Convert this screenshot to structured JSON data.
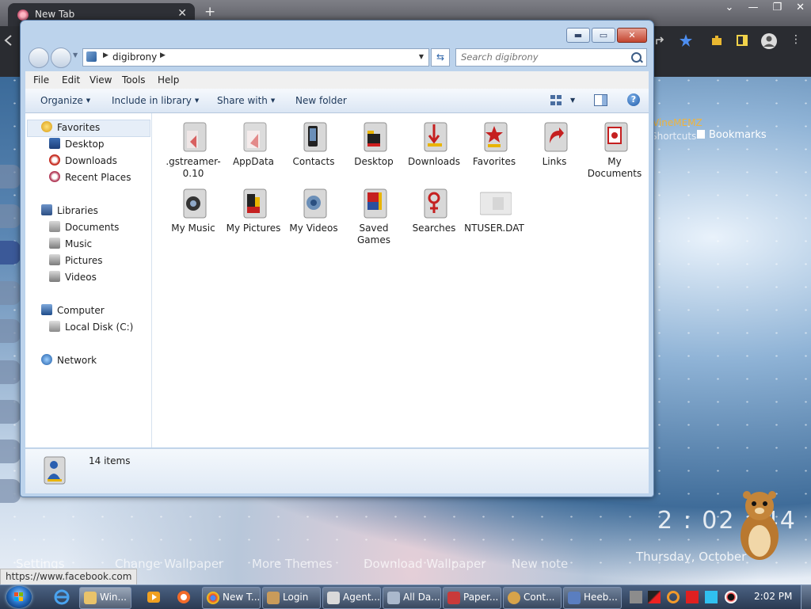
{
  "browser": {
    "tab_title": "New Tab",
    "tab_close": "✕",
    "new_tab": "+",
    "bookmark_vinememz": "VineMEMZ",
    "shortcuts": "Shortcuts",
    "bookmarks": "Bookmarks",
    "bottom_links": [
      "Settings",
      "Change Wallpaper",
      "More Themes",
      "Download Wallpaper",
      "New note"
    ],
    "status_url": "https://www.facebook.com",
    "clock": "2 : 02 : 44",
    "date": "Thursday, October"
  },
  "explorer": {
    "address": {
      "crumb": "digibrony"
    },
    "search": {
      "placeholder": "Search digibrony"
    },
    "menu": [
      "File",
      "Edit",
      "View",
      "Tools",
      "Help"
    ],
    "commands": {
      "organize": "Organize",
      "include": "Include in library",
      "share": "Share with",
      "new_folder": "New folder"
    },
    "nav": {
      "favorites": "Favorites",
      "favorites_items": [
        "Desktop",
        "Downloads",
        "Recent Places"
      ],
      "libraries": "Libraries",
      "libraries_items": [
        "Documents",
        "Music",
        "Pictures",
        "Videos"
      ],
      "computer": "Computer",
      "computer_items": [
        "Local Disk (C:)"
      ],
      "network": "Network"
    },
    "files": [
      {
        "name": ".gstreamer-0.10",
        "icon": "folder-icon"
      },
      {
        "name": "AppData",
        "icon": "folder-icon"
      },
      {
        "name": "Contacts",
        "icon": "contacts-folder-icon"
      },
      {
        "name": "Desktop",
        "icon": "desktop-folder-icon"
      },
      {
        "name": "Downloads",
        "icon": "downloads-folder-icon"
      },
      {
        "name": "Favorites",
        "icon": "favorites-folder-icon"
      },
      {
        "name": "Links",
        "icon": "links-folder-icon"
      },
      {
        "name": "My Documents",
        "icon": "documents-folder-icon"
      },
      {
        "name": "My Music",
        "icon": "music-folder-icon"
      },
      {
        "name": "My Pictures",
        "icon": "pictures-folder-icon"
      },
      {
        "name": "My Videos",
        "icon": "videos-folder-icon"
      },
      {
        "name": "Saved Games",
        "icon": "saved-games-folder-icon"
      },
      {
        "name": "Searches",
        "icon": "searches-folder-icon"
      },
      {
        "name": "NTUSER.DAT",
        "icon": "file-icon"
      }
    ],
    "details": {
      "count": "14 items"
    }
  },
  "taskbar": {
    "tasks": [
      "Win...",
      "New T...",
      "Login",
      "Agent...",
      "All Da...",
      "Paper...",
      "Cont...",
      "Heeb..."
    ],
    "time": "2:02 PM"
  },
  "colors": {
    "accent": "#2a62a8",
    "close": "#c3452f",
    "taskbar": "#2a3a52"
  }
}
